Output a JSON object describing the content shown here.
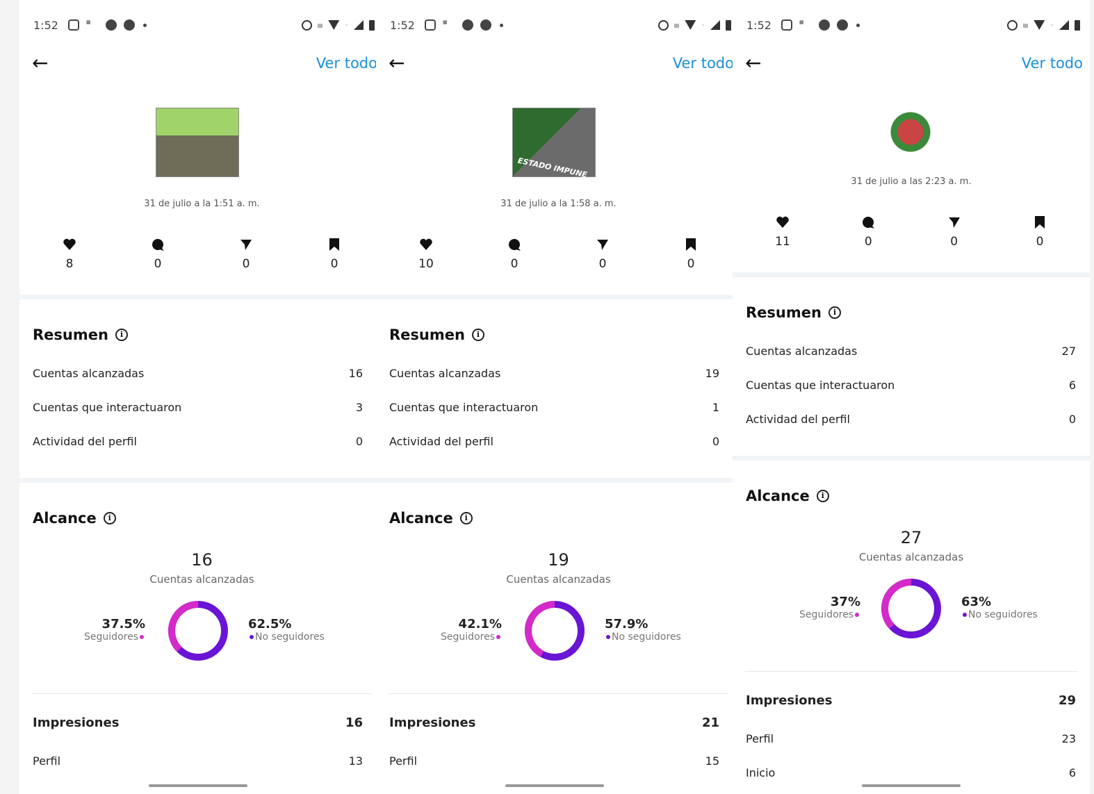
{
  "status_time": "1:52",
  "nav": {
    "view_all": "Ver todo"
  },
  "labels": {
    "summary": "Resumen",
    "reach": "Alcance",
    "accounts_reached": "Cuentas alcanzadas",
    "accounts_engaged": "Cuentas que interactuaron",
    "profile_activity": "Actividad del perfil",
    "accounts_reached_caption": "Cuentas alcanzadas",
    "followers": "Seguidores",
    "non_followers": "No seguidores",
    "impressions": "Impresiones",
    "profile": "Perfil",
    "home": "Inicio"
  },
  "colors": {
    "accent": "#1a8fd8",
    "followers": "#d42ac9",
    "non_followers": "#6a14d6"
  },
  "posts": [
    {
      "date": "31 de julio a la 1:51 a. m.",
      "likes": "8",
      "comments": "0",
      "shares": "0",
      "saves": "0",
      "reached": "16",
      "engaged": "3",
      "profile_activity": "0",
      "reach_total": "16",
      "followers_pct": "37.5%",
      "non_followers_pct": "62.5%",
      "followers_fraction": 0.375,
      "impressions": "16",
      "impr_profile": "13"
    },
    {
      "date": "31 de julio a la 1:58 a. m.",
      "likes": "10",
      "comments": "0",
      "shares": "0",
      "saves": "0",
      "reached": "19",
      "engaged": "1",
      "profile_activity": "0",
      "reach_total": "19",
      "followers_pct": "42.1%",
      "non_followers_pct": "57.9%",
      "followers_fraction": 0.421,
      "impressions": "21",
      "impr_profile": "15",
      "thumb_text": "ESTADO IMPUNE"
    },
    {
      "date": "31 de julio a las 2:23 a. m.",
      "likes": "11",
      "comments": "0",
      "shares": "0",
      "saves": "0",
      "reached": "27",
      "engaged": "6",
      "profile_activity": "0",
      "reach_total": "27",
      "followers_pct": "37%",
      "non_followers_pct": "63%",
      "followers_fraction": 0.37,
      "impressions": "29",
      "impr_profile": "23",
      "impr_home": "6"
    }
  ]
}
